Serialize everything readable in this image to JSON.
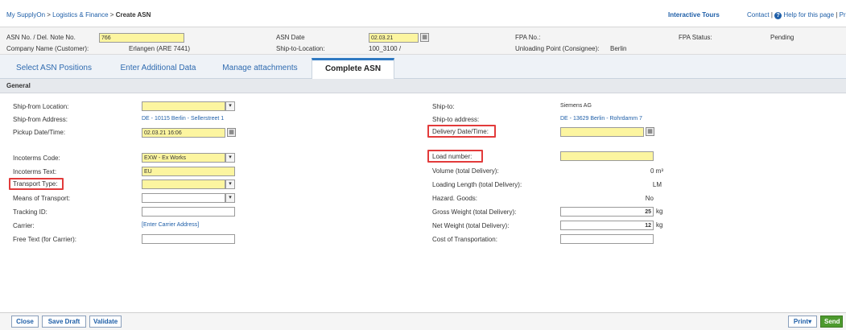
{
  "breadcrumb": {
    "item1": "My SupplyOn",
    "sep1": ">",
    "item2": "Logistics & Finance",
    "sep2": ">",
    "current": "Create ASN"
  },
  "topnav": {
    "tours": "Interactive Tours",
    "contact": "Contact",
    "sep": "|",
    "help": "Help for this page",
    "sep2": "|",
    "print": "Pri"
  },
  "header": {
    "asn_no_label": "ASN No. / Del. Note No.",
    "asn_no_value": "766",
    "asn_date_label": "ASN Date",
    "asn_date_value": "02.03.21",
    "fpa_no_label": "FPA No.:",
    "fpa_status_label": "FPA Status:",
    "fpa_status_value": "Pending",
    "company_label": "Company Name (Customer):",
    "company_value": "Erlangen (ARE 7441)",
    "ship_to_loc_label": "Ship-to-Location:",
    "ship_to_loc_value": "100_3100 /",
    "unloading_label": "Unloading Point (Consignee):",
    "unloading_value": "Berlin"
  },
  "tabs": [
    {
      "label": "Select ASN Positions"
    },
    {
      "label": "Enter Additional Data"
    },
    {
      "label": "Manage attachments"
    },
    {
      "label": "Complete ASN"
    }
  ],
  "section_title": "General",
  "left_form": {
    "ship_from_loc_label": "Ship-from Location:",
    "ship_from_addr_label": "Ship-from Address:",
    "ship_from_addr_value": "DE - 10115 Berlin - Sellerstreet 1",
    "pickup_label": "Pickup Date/Time:",
    "pickup_value": "02.03.21 16:06",
    "incoterms_code_label": "Incoterms Code:",
    "incoterms_code_value": "EXW - Ex Works",
    "incoterms_text_label": "Incoterms Text:",
    "incoterms_text_value": "EU",
    "transport_type_label": "Transport Type:",
    "means_label": "Means of Transport:",
    "tracking_label": "Tracking ID:",
    "carrier_label": "Carrier:",
    "carrier_link": "[Enter Carrier Address]",
    "free_text_label": "Free Text (for Carrier):"
  },
  "right_form": {
    "ship_to_label": "Ship-to:",
    "ship_to_value": "Siemens AG",
    "ship_to_addr_label": "Ship-to address:",
    "ship_to_addr_value": "DE - 13629 Berlin - Rohrdamm 7",
    "delivery_label": "Delivery Date/Time:",
    "load_label": "Load number:",
    "volume_label": "Volume (total Delivery):",
    "volume_value": "0 m³",
    "loading_length_label": "Loading Length (total Delivery):",
    "loading_length_value": "LM",
    "hazard_label": "Hazard. Goods:",
    "hazard_value": "No",
    "gross_label": "Gross Weight (total Delivery):",
    "gross_value": "25",
    "gross_unit": "kg",
    "net_label": "Net Weight (total Delivery):",
    "net_value": "12",
    "net_unit": "kg",
    "cost_label": "Cost of Transportation:"
  },
  "footer": {
    "close": "Close",
    "save_draft": "Save Draft",
    "validate": "Validate",
    "print": "Print",
    "send": "Send"
  },
  "icons": {
    "dropdown": "▾",
    "calendar": "▦",
    "help": "?"
  },
  "colors": {
    "required_field": "#fcf5a0",
    "highlight": "#e23b3b",
    "tab_accent": "#2f79c2",
    "send_button": "#4d9a2e"
  }
}
